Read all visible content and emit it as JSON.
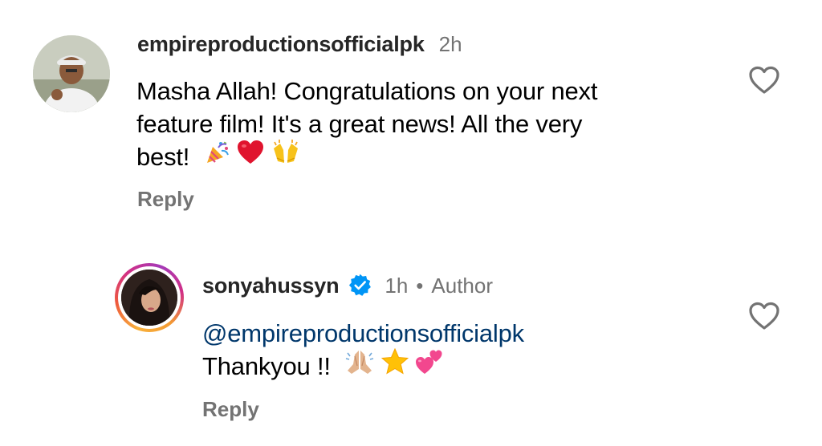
{
  "comments": [
    {
      "username": "empireproductionsofficialpk",
      "time": "2h",
      "text_lines": [
        "Masha Allah! Congratulations on your next",
        "feature film! It's a great news! All the very",
        "best!"
      ],
      "emojis": [
        "party-popper",
        "red-heart",
        "raising-hands"
      ],
      "reply_label": "Reply"
    },
    {
      "username": "sonyahussyn",
      "verified": true,
      "time": "1h",
      "separator": "•",
      "author_badge": "Author",
      "mention": "@empireproductionsofficialpk",
      "text": "Thankyou !!",
      "emojis": [
        "folded-hands",
        "star",
        "two-hearts"
      ],
      "reply_label": "Reply"
    }
  ],
  "colors": {
    "username": "#262626",
    "meta": "#737373",
    "mention": "#00376b",
    "verified": "#0095f6",
    "heart_outline": "#737373"
  }
}
